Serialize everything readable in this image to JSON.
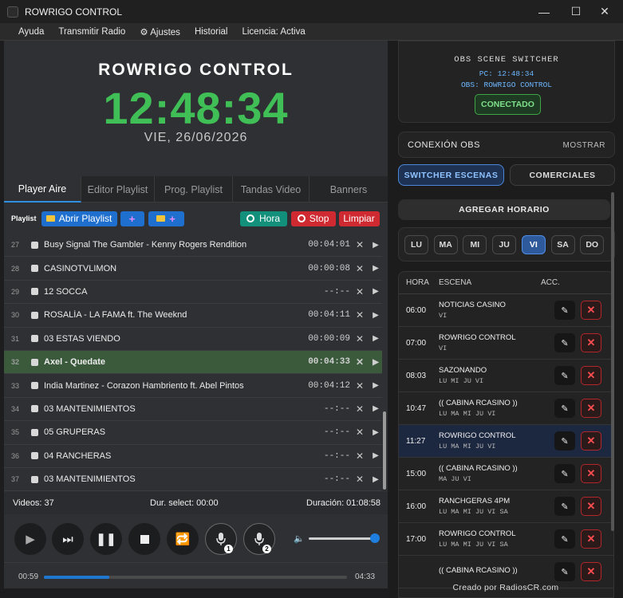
{
  "window": {
    "title": "ROWRIGO CONTROL",
    "controls": [
      "—",
      "☐",
      "✕"
    ]
  },
  "menu": [
    "Ayuda",
    "Transmitir Radio",
    "⚙ Ajustes",
    "Historial",
    "Licencia: Activa"
  ],
  "header": {
    "station": "ROWRIGO CONTROL",
    "clock": "12:48:34",
    "date": "VIE, 26/06/2026"
  },
  "tabs": [
    "Player Aire",
    "Editor Playlist",
    "Prog. Playlist",
    "Tandas Video",
    "Banners"
  ],
  "toolbar": {
    "label": "Playlist",
    "open": "Abrir Playlist",
    "plus": "+",
    "hora": "Hora",
    "stop": "Stop",
    "limpiar": "Limpiar"
  },
  "playlist": [
    {
      "n": "27",
      "title": "Busy Signal The Gambler - Kenny Rogers Rendition",
      "dur": "00:04:01"
    },
    {
      "n": "28",
      "title": "CASINOTVLIMON",
      "dur": "00:00:08"
    },
    {
      "n": "29",
      "title": "12 SOCCA",
      "dur": "--:--"
    },
    {
      "n": "30",
      "title": "ROSALÍA - LA FAMA ft. The Weeknd",
      "dur": "00:04:11"
    },
    {
      "n": "31",
      "title": "03 ESTAS VIENDO",
      "dur": "00:00:09"
    },
    {
      "n": "32",
      "title": "Axel - Quedate",
      "dur": "00:04:33"
    },
    {
      "n": "33",
      "title": "India Martinez - Corazon Hambriento ft. Abel Pintos",
      "dur": "00:04:12"
    },
    {
      "n": "34",
      "title": "03 MANTENIMIENTOS",
      "dur": "--:--"
    },
    {
      "n": "35",
      "title": "05 GRUPERAS",
      "dur": "--:--"
    },
    {
      "n": "36",
      "title": "04 RANCHERAS",
      "dur": "--:--"
    },
    {
      "n": "37",
      "title": "03 MANTENIMIENTOS",
      "dur": "--:--"
    }
  ],
  "row_icons": {
    "remove": "✕",
    "play": "▶"
  },
  "status": {
    "videos": "Videos: 37",
    "dur_select": "Dur. select: 00:00",
    "duracion": "Duración: 01:08:58"
  },
  "mic_badges": [
    "1",
    "2"
  ],
  "progress": {
    "elapsed": "00:59",
    "total": "04:33",
    "fraction": 0.2161
  },
  "volume": {
    "level": 1.0
  },
  "obs": {
    "title": "OBS SCENE SWITCHER",
    "pc": "PC: 12:48:34",
    "obs": "OBS: ROWRIGO CONTROL",
    "status": "CONECTADO"
  },
  "conexion": {
    "label": "CONEXIÓN OBS",
    "action": "MOSTRAR"
  },
  "right_tabs": {
    "switcher": "SWITCHER ESCENAS",
    "comerciales": "COMERCIALES"
  },
  "agregar": "AGREGAR HORARIO",
  "days": [
    {
      "label": "LU",
      "on": false
    },
    {
      "label": "MA",
      "on": false
    },
    {
      "label": "MI",
      "on": false
    },
    {
      "label": "JU",
      "on": false
    },
    {
      "label": "VI",
      "on": true
    },
    {
      "label": "SA",
      "on": false
    },
    {
      "label": "DO",
      "on": false
    }
  ],
  "schedule_headers": {
    "hora": "HORA",
    "escena": "ESCENA",
    "acc": "ACC."
  },
  "schedule": [
    {
      "hora": "06:00",
      "escena": "NOTICIAS CASINO",
      "dias": "VI"
    },
    {
      "hora": "07:00",
      "escena": "ROWRIGO CONTROL",
      "dias": "VI"
    },
    {
      "hora": "08:03",
      "escena": "SAZONANDO",
      "dias": "LU MI JU VI"
    },
    {
      "hora": "10:47",
      "escena": "(( CABINA RCASINO ))",
      "dias": "LU MA MI JU VI"
    },
    {
      "hora": "11:27",
      "escena": "ROWRIGO CONTROL",
      "dias": "LU MA MI JU VI"
    },
    {
      "hora": "15:00",
      "escena": "(( CABINA RCASINO ))",
      "dias": "MA JU VI"
    },
    {
      "hora": "16:00",
      "escena": "RANCHGERAS 4PM",
      "dias": "LU MA MI JU VI SA"
    },
    {
      "hora": "17:00",
      "escena": "ROWRIGO CONTROL",
      "dias": "LU MA MI JU VI SA"
    },
    {
      "hora": "",
      "escena": "(( CABINA RCASINO ))",
      "dias": ""
    }
  ],
  "footer": "Creado por RadiosCR.com",
  "colors": {
    "accent": "#1f78d0",
    "clock": "#3fbf55",
    "selected_row": "#3b5a3c"
  }
}
